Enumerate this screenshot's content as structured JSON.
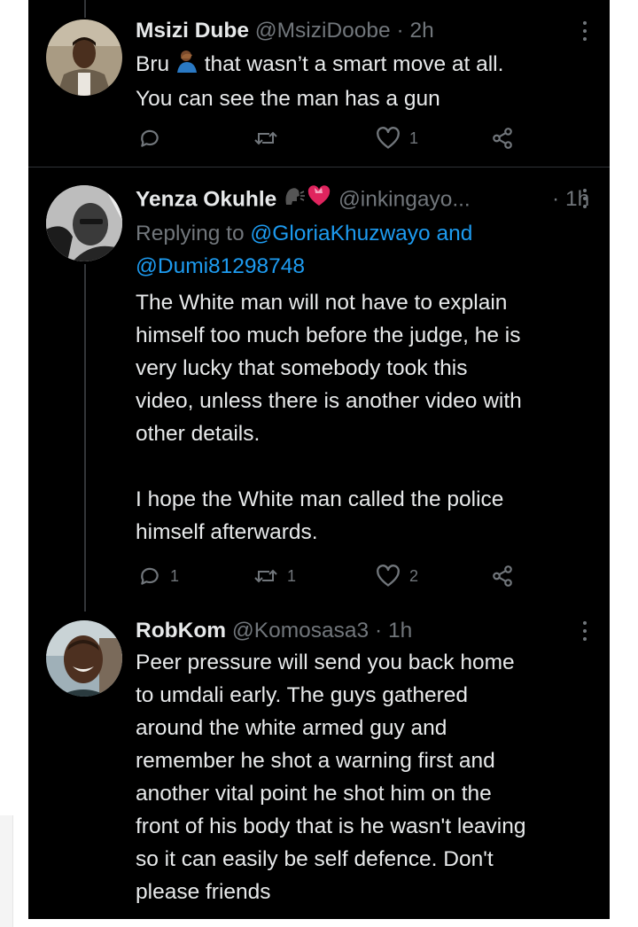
{
  "colors": {
    "background": "#000000",
    "text": "#e7e9ea",
    "secondary": "#71767b",
    "link": "#1d9bf0",
    "divider": "#2f3336"
  },
  "tweets": [
    {
      "name": "Msizi Dube",
      "handle": "@MsiziDoobe",
      "dot": "·",
      "time": "2h",
      "text_before_emoji": "Bru ",
      "emoji": "person-facepalming-emoji",
      "text_after_emoji": " that wasn’t a smart move at all.\nYou can see the man has a gun",
      "replies": "",
      "retweets": "",
      "likes": "1"
    },
    {
      "name": "Yenza Okuhle",
      "name_emojis": [
        "speaking-head-emoji",
        "heart-with-ribbon-emoji"
      ],
      "handle": "@inkingayo...",
      "dot": "·",
      "time": "1h",
      "replying_prefix": "Replying to ",
      "mention1": "@GloriaKhuzwayo",
      "mention_join": " and",
      "mention2": "@Dumi81298748",
      "text": "The White man will not have to explain\nhimself too much before the judge, he is\nvery lucky that somebody took this\nvideo, unless there is another video with\nother details.\n\nI hope the White man called the police\nhimself afterwards.",
      "replies": "1",
      "retweets": "1",
      "likes": "2"
    },
    {
      "name": "RobKom",
      "handle": "@Komosasa3",
      "dot": "·",
      "time": "1h",
      "text": "Peer pressure will send you back home\nto umdali early. The guys gathered\naround the white armed guy and\nremember he shot a warning first and\nanother vital point he shot him on the\nfront of his body that is he wasn't leaving\nso it can easily be self defence. Don't\nplease friends"
    }
  ]
}
